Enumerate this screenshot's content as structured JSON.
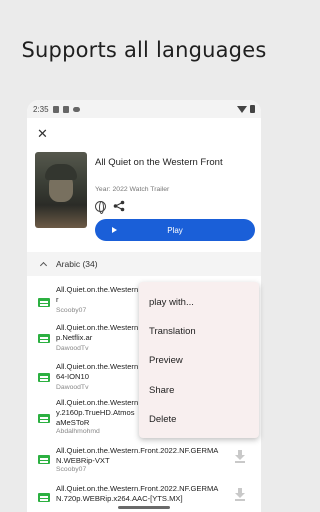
{
  "headline": "Supports all languages",
  "status_bar": {
    "time": "2:35"
  },
  "movie": {
    "title": "All Quiet on the Western Front",
    "year_line": "Year: 2022 Watch Trailer",
    "play_label": "Play"
  },
  "group": {
    "label": "Arabic (34)"
  },
  "subtitles": [
    {
      "filename_lines": [
        "All.Quiet.on.the.Western",
        "r"
      ],
      "uploader": "Scooby07"
    },
    {
      "filename_lines": [
        "All.Quiet.on.the.Western",
        "p.Netflix.ar"
      ],
      "uploader": "DawoodTv"
    },
    {
      "filename_lines": [
        "All.Quiet.on.the.Western",
        "64-ION10"
      ],
      "uploader": "DawoodTv"
    },
    {
      "filename_lines": [
        "All.Quiet.on.the.Western",
        "y.2160p.TrueHD.Atmos",
        "aMeSToR"
      ],
      "uploader": "Abdalhmohmd"
    },
    {
      "filename_lines": [
        "All.Quiet.on.the.Western.Front.2022.NF.GERMA",
        "N.WEBRip-VXT"
      ],
      "uploader": "Scooby07"
    },
    {
      "filename_lines": [
        "All.Quiet.on.the.Western.Front.2022.NF.GERMA",
        "N.720p.WEBRip.x264.AAC-[YTS.MX]"
      ],
      "uploader": ""
    }
  ],
  "context_menu": {
    "items": [
      "play with...",
      "Translation",
      "Preview",
      "Share",
      "Delete"
    ]
  },
  "colors": {
    "accent": "#1a5fd8",
    "file_icon": "#2cb041",
    "menu_bg": "#f8efef"
  }
}
